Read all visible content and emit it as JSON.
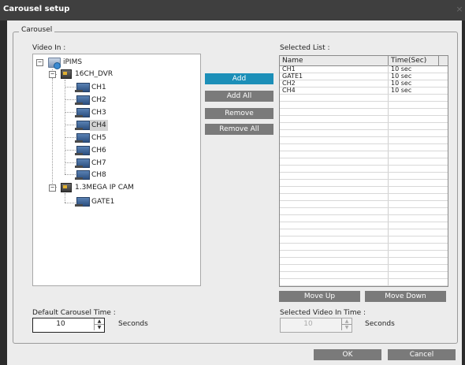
{
  "window": {
    "title": "Carousel setup",
    "close_glyph": "×"
  },
  "group": {
    "label": "Carousel"
  },
  "video_in": {
    "label": "Video In :"
  },
  "tree": {
    "root": "iPIMS",
    "dvr": "16CH_DVR",
    "channels": [
      "CH1",
      "CH2",
      "CH3",
      "CH4",
      "CH5",
      "CH6",
      "CH7",
      "CH8"
    ],
    "selected_channel": "CH4",
    "ipcam": "1.3MEGA IP CAM",
    "ipcam_children": [
      "GATE1"
    ]
  },
  "buttons": {
    "add": "Add",
    "add_all": "Add All",
    "remove": "Remove",
    "remove_all": "Remove All",
    "move_up": "Move Up",
    "move_down": "Move Down",
    "ok": "OK",
    "cancel": "Cancel"
  },
  "selected_list": {
    "label": "Selected List :",
    "columns": [
      "Name",
      "Time(Sec)"
    ],
    "rows": [
      {
        "name": "CH1",
        "time": "10 sec"
      },
      {
        "name": "GATE1",
        "time": "10 sec"
      },
      {
        "name": "CH2",
        "time": "10 sec"
      },
      {
        "name": "CH4",
        "time": "10 sec"
      }
    ]
  },
  "default_time": {
    "label": "Default Carousel Time :",
    "value": "10",
    "unit": "Seconds"
  },
  "selected_time": {
    "label": "Selected Video In Time :",
    "value": "10",
    "unit": "Seconds"
  },
  "colors": {
    "accent": "#1c8fb8",
    "button": "#7a7a7a",
    "titlebar": "#3f3f3f"
  },
  "icons": {
    "root": "network-icon",
    "dvr": "dvr-icon",
    "camera": "camera-icon"
  }
}
